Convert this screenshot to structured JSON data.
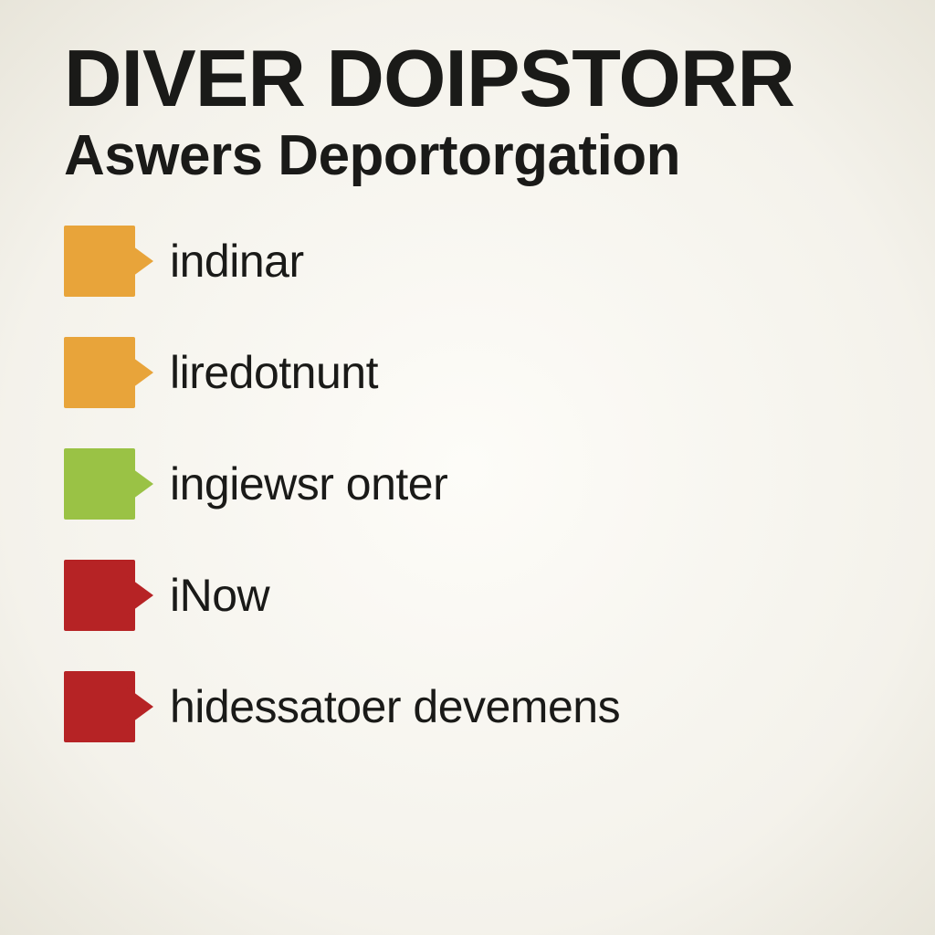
{
  "title": "DIVER DOIPSTORR",
  "subtitle": "Aswers Deportorgation",
  "items": [
    {
      "label": "indinar",
      "color": "#e8a43a",
      "pointer": "#e8a43a"
    },
    {
      "label": "liredotnunt",
      "color": "#e8a43a",
      "pointer": "#e8a43a"
    },
    {
      "label": "ingiewsr onter",
      "color": "#9ac245",
      "pointer": "#9ac245"
    },
    {
      "label": "iNow",
      "color": "#b62325",
      "pointer": "#b62325"
    },
    {
      "label": "hidessatoer devemens",
      "color": "#b62325",
      "pointer": "#b62325"
    }
  ]
}
